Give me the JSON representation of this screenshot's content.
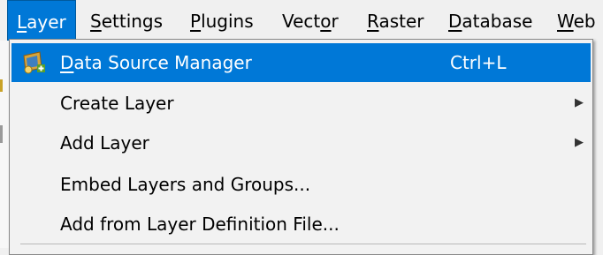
{
  "menubar": {
    "items": [
      {
        "label_pre": "",
        "label_u": "L",
        "label_post": "ayer",
        "active": true
      },
      {
        "label_pre": "",
        "label_u": "S",
        "label_post": "ettings",
        "active": false
      },
      {
        "label_pre": "",
        "label_u": "P",
        "label_post": "lugins",
        "active": false
      },
      {
        "label_pre": "Vect",
        "label_u": "o",
        "label_post": "r",
        "active": false
      },
      {
        "label_pre": "",
        "label_u": "R",
        "label_post": "aster",
        "active": false
      },
      {
        "label_pre": "",
        "label_u": "D",
        "label_post": "atabase",
        "active": false
      },
      {
        "label_pre": "",
        "label_u": "W",
        "label_post": "eb",
        "active": false
      }
    ]
  },
  "layer_menu": {
    "items": [
      {
        "label_u": "D",
        "label_post": "ata Source Manager",
        "shortcut": "Ctrl+L",
        "icon": "data-source-manager-icon",
        "has_submenu": false,
        "highlighted": true
      },
      {
        "label_u": "",
        "label_post": "Create Layer",
        "shortcut": "",
        "icon": "",
        "has_submenu": true,
        "highlighted": false
      },
      {
        "label_u": "",
        "label_post": "Add Layer",
        "shortcut": "",
        "icon": "",
        "has_submenu": true,
        "highlighted": false
      },
      {
        "label_u": "",
        "label_post": "Embed Layers and Groups...",
        "shortcut": "",
        "icon": "",
        "has_submenu": false,
        "highlighted": false
      },
      {
        "label_u": "",
        "label_post": "Add from Layer Definition File...",
        "shortcut": "",
        "icon": "",
        "has_submenu": false,
        "highlighted": false
      }
    ],
    "submenu_arrow": "▶"
  },
  "colors": {
    "highlight": "#0078d7",
    "menu_bg": "#f2f2f2",
    "menubar_bg": "#f0f0f0"
  }
}
